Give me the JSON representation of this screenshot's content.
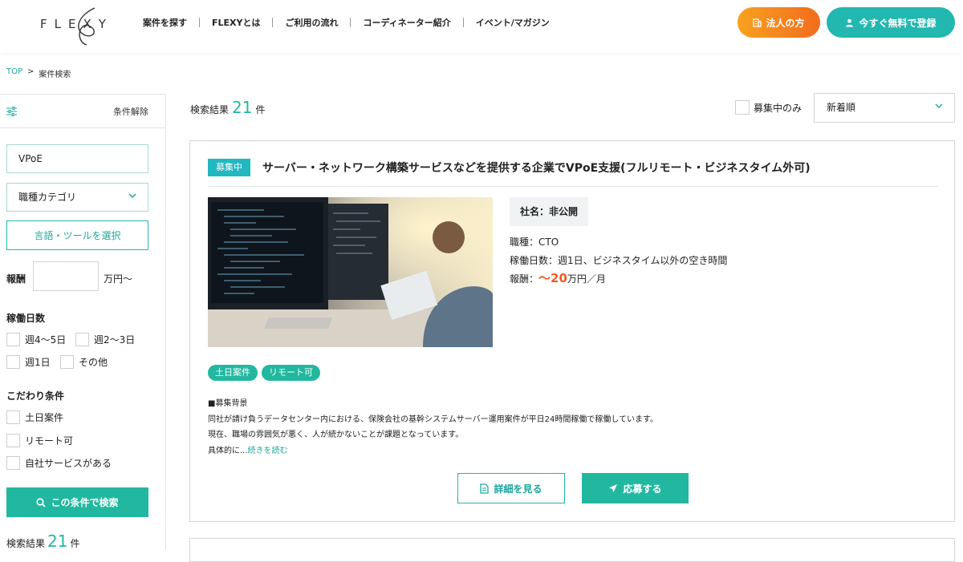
{
  "header": {
    "logo": "FLEXY",
    "nav": [
      "案件を探す",
      "FLEXYとは",
      "ご利用の流れ",
      "コーディネーター紹介",
      "イベント/マガジン"
    ],
    "corp_button": "法人の方",
    "register_button": "今すぐ無料で登録"
  },
  "breadcrumb": {
    "top": "TOP",
    "sep": ">",
    "current": "案件検索"
  },
  "sidebar": {
    "clear_label": "条件解除",
    "keyword_value": "VPoE",
    "category_select": "職種カテゴリ",
    "lang_tool_button": "言語・ツールを選択",
    "pay_label": "報酬",
    "pay_unit": "万円〜",
    "days_title": "稼働日数",
    "days_options": [
      "週4〜5日",
      "週2〜3日",
      "週1日",
      "その他"
    ],
    "pref_title": "こだわり条件",
    "pref_options": [
      "土日案件",
      "リモート可",
      "自社サービスがある"
    ],
    "search_button": "この条件で検索",
    "result_label": "検索結果",
    "result_count": "21",
    "result_unit": "件"
  },
  "main": {
    "result_label": "検索結果",
    "result_count": "21",
    "result_unit": "件",
    "recruiting_only_label": "募集中のみ",
    "sort_value": "新着順"
  },
  "job": {
    "status": "募集中",
    "title": "サーバー・ネットワーク構築サービスなどを提供する企業でVPoE支援(フルリモート・ビジネスタイム外可)",
    "company": "社名：非公開",
    "role": "職種：CTO",
    "work_days": "稼働日数：週1日、ビジネスタイム以外の空き時間",
    "pay_prefix": "報酬：",
    "pay_amount": "〜20",
    "pay_suffix": "万円／月",
    "tags": [
      "土日案件",
      "リモート可"
    ],
    "desc_heading": "■募集背景",
    "desc_line1": "同社が請け負うデータセンター内における、保険会社の基幹システムサーバー運用案件が平日24時間稼働で稼働しています。",
    "desc_line2": "現在、職場の雰囲気が悪く、人が続かないことが課題となっています。",
    "desc_line3": "具体的に...",
    "read_more": "続きを読む",
    "detail_button": "詳細を見る",
    "apply_button": "応募する"
  },
  "colors": {
    "accent": "#22b8a0",
    "orange": "#f36c1d",
    "pay": "#f05a24"
  }
}
